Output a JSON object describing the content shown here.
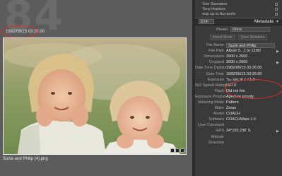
{
  "grid": {
    "cell_index": "84",
    "capture_datetime": "1982/06/15 03:26:00",
    "photo_filename": "Suzie and Philip (4).png"
  },
  "panel": {
    "collections": [
      {
        "label": "Tom Saunders"
      },
      {
        "label": "Tony Hopkins"
      },
      {
        "label": "way up to Acropolis"
      }
    ],
    "metadata_header": {
      "preset_select": "EXIF",
      "title": "Metadata",
      "toggle": "▾"
    },
    "preset": {
      "label": "Preset",
      "value": "None"
    },
    "buttons": [
      "Import Mode",
      "Save Metadata"
    ],
    "rows": [
      {
        "label": "File Name",
        "value": "Suzie and Philip",
        "input": true
      },
      {
        "label": "File Path",
        "value": "Album 5...1 to 12/82"
      },
      {
        "label": "Dimensions",
        "value": "3900 x 2600"
      },
      {
        "label": "Cropped",
        "value": "3900 x 2600"
      },
      {
        "label": "Date Time Digitized",
        "value": "1982/06/15 03:26:00"
      },
      {
        "label": "Date Time",
        "value": "1982/06/15 03:26:00"
      },
      {
        "label": "Exposure",
        "value": "⅟₆₀ sec at ƒ / 1.0"
      },
      {
        "label": "ISO Speed Rating",
        "value": "ISO 0"
      },
      {
        "label": "Flash",
        "value": "Did not fire"
      },
      {
        "label": "Exposure Program",
        "value": "Aperture priority"
      },
      {
        "label": "Metering Mode",
        "value": "Pattern"
      },
      {
        "label": "Make",
        "value": "Zoran"
      },
      {
        "label": "Model",
        "value": "COACH"
      },
      {
        "label": "Software",
        "value": "COACHWare 1.0"
      },
      {
        "label": "User Comment",
        "value": ""
      },
      {
        "label": "GPS",
        "value": "34°155.236' S"
      },
      {
        "label": "Altitude",
        "value": ""
      },
      {
        "label": "Direction",
        "value": ""
      }
    ]
  },
  "annotations": {
    "color": "#d8322a"
  }
}
